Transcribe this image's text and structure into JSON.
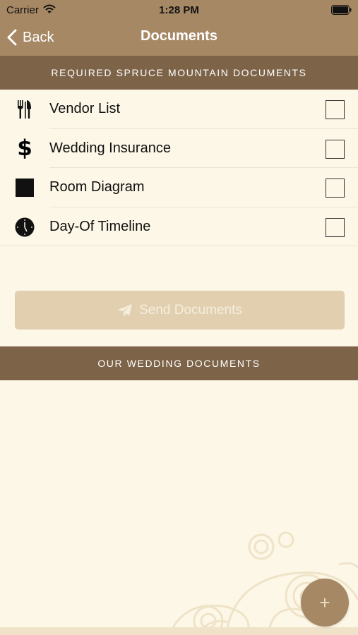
{
  "status_bar": {
    "carrier": "Carrier",
    "time": "1:28 PM",
    "wifi_icon": "wifi-icon",
    "battery_icon": "battery-icon"
  },
  "nav": {
    "back_label": "Back",
    "title": "Documents"
  },
  "required_section": {
    "header": "REQUIRED SPRUCE MOUNTAIN DOCUMENTS",
    "items": [
      {
        "label": "Vendor List",
        "icon": "fork-knife-icon",
        "checked": false
      },
      {
        "label": "Wedding Insurance",
        "icon": "dollar-icon",
        "checked": false
      },
      {
        "label": "Room Diagram",
        "icon": "square-icon",
        "checked": false
      },
      {
        "label": "Day-Of Timeline",
        "icon": "clock-icon",
        "checked": false
      }
    ]
  },
  "send_button": {
    "label": "Send Documents",
    "icon": "paper-plane-icon"
  },
  "our_section": {
    "header": "OUR WEDDING DOCUMENTS"
  },
  "fab": {
    "label": "+"
  },
  "colors": {
    "nav_background": "#a68865",
    "section_header": "#7d6449",
    "page_background": "#fdf7e7",
    "send_button_disabled": "#e1cfb0"
  }
}
